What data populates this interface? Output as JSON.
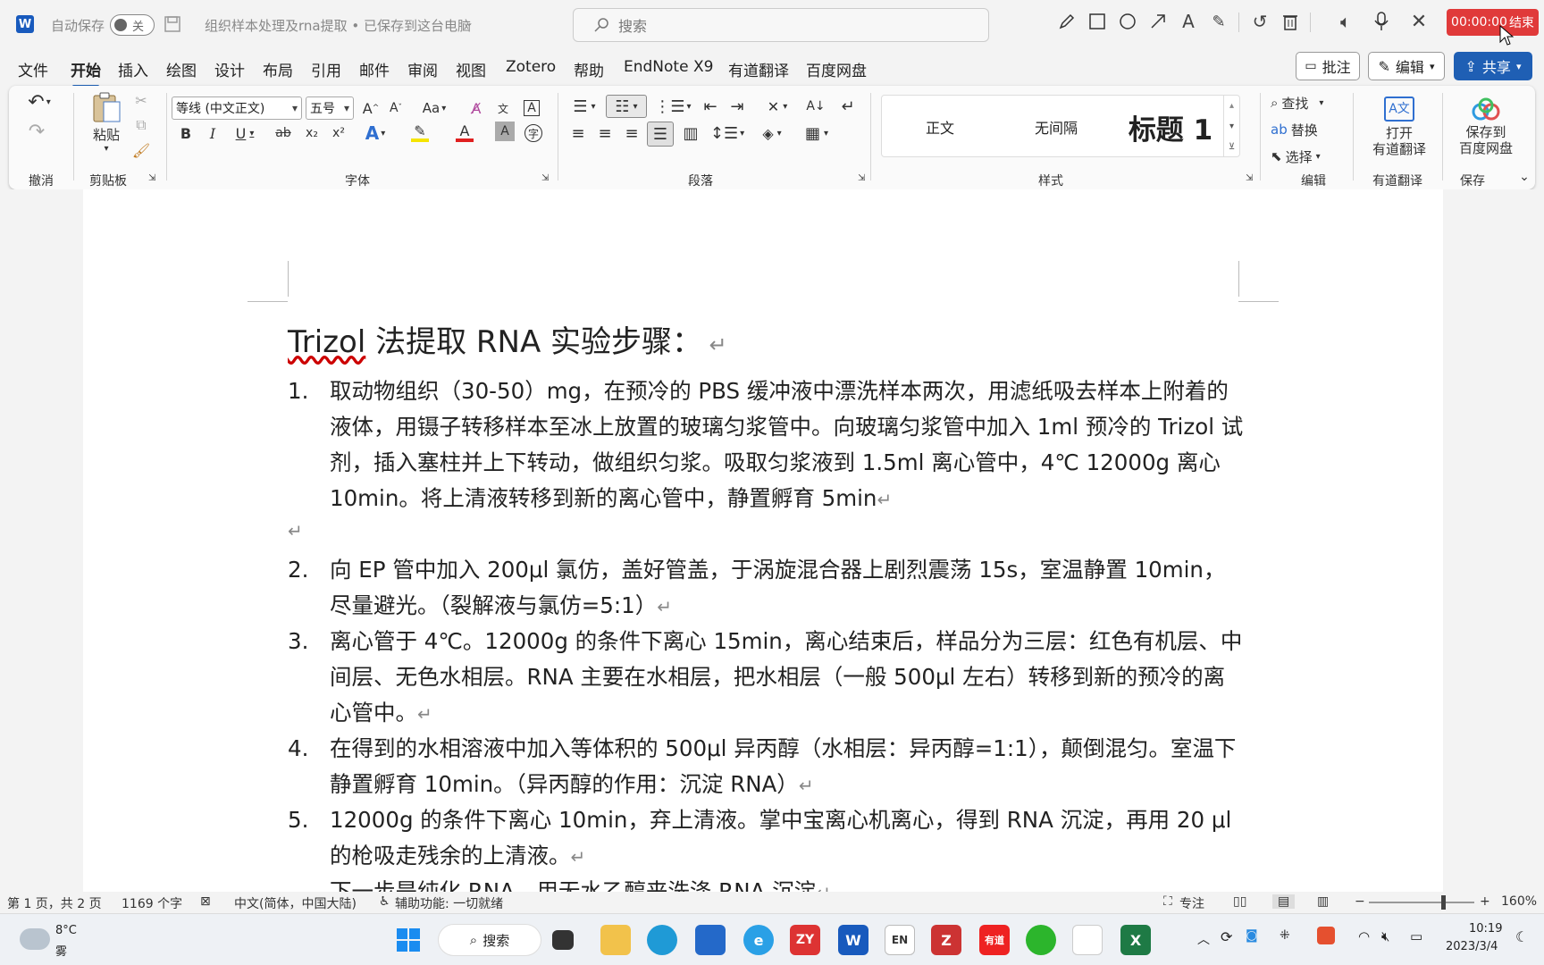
{
  "titlebar": {
    "autosave_label": "自动保存",
    "autosave_state": "关",
    "doc_title": "组织样本处理及rna提取 • 已保存到这台电脑",
    "search_placeholder": "搜索",
    "recording_time": "00:00:00",
    "recording_end": "结束"
  },
  "menu": {
    "items": [
      "文件",
      "开始",
      "插入",
      "绘图",
      "设计",
      "布局",
      "引用",
      "邮件",
      "审阅",
      "视图",
      "Zotero",
      "帮助",
      "EndNote X9",
      "有道翻译",
      "百度网盘"
    ],
    "active": "开始",
    "comment_btn": "批注",
    "edit_btn": "编辑",
    "share_btn": "共享"
  },
  "ribbon": {
    "groups": [
      "撤消",
      "剪贴板",
      "字体",
      "段落",
      "样式",
      "编辑",
      "有道翻译",
      "保存"
    ],
    "paste_label": "粘贴",
    "font_name": "等线 (中文正文)",
    "font_size": "五号",
    "styles": [
      "正文",
      "无间隔",
      "标题 1"
    ],
    "find": "查找",
    "replace": "替换",
    "select": "选择",
    "youdao_btn": "打开\n有道翻译",
    "youdao_line1": "打开",
    "youdao_line2": "有道翻译",
    "baidu_line1": "保存到",
    "baidu_line2": "百度网盘",
    "font_glyph_aa": "Aa",
    "bold": "B",
    "italic": "I",
    "underline": "U",
    "strike": "ab",
    "sub": "x₂",
    "sup": "x²"
  },
  "document": {
    "title_part1": "Trizol",
    "title_part2": " 法提取 RNA 实验步骤：",
    "items": [
      {
        "num": "1.",
        "text": "取动物组织（30-50）mg，在预冷的 PBS 缓冲液中漂洗样本两次，用滤纸吸去样本上附着的液体，用镊子转移样本至冰上放置的玻璃匀浆管中。向玻璃匀浆管中加入 1ml 预冷的 Trizol 试剂，插入塞柱并上下转动，做组织匀浆。吸取匀浆液到 1.5ml 离心管中，4℃ 12000g 离心 10min。将上清液转移到新的离心管中，静置孵育 5min"
      },
      {
        "num": "2.",
        "text": "向 EP 管中加入 200μl 氯仿，盖好管盖，于涡旋混合器上剧烈震荡 15s，室温静置 10min，尽量避光。（裂解液与氯仿=5:1）"
      },
      {
        "num": "3.",
        "text": "离心管于 4℃。12000g 的条件下离心 15min，离心结束后，样品分为三层：红色有机层、中间层、无色水相层。RNA 主要在水相层，把水相层（一般 500μl 左右）转移到新的预冷的离心管中。"
      },
      {
        "num": "4.",
        "text": "在得到的水相溶液中加入等体积的 500μl 异丙醇（水相层：异丙醇=1:1），颠倒混匀。室温下静置孵育 10min。（异丙醇的作用：沉淀 RNA）"
      },
      {
        "num": "5.",
        "text": "12000g 的条件下离心 10min，弃上清液。掌中宝离心机离心，得到 RNA 沉淀，再用 20 μl 的枪吸走残余的上清液。"
      },
      {
        "num": "",
        "text": "下一步是纯化 RNA，用无水乙醇来洗涤 RNA 沉淀"
      }
    ]
  },
  "status": {
    "page": "第 1 页，共 2 页",
    "words": "1169 个字",
    "lang": "中文(简体，中国大陆)",
    "a11y": "辅助功能: 一切就绪",
    "focus": "专注",
    "zoom": "160%",
    "zoom_level": 0.72
  },
  "taskbar": {
    "weather_temp": "8°C",
    "weather_desc": "雾",
    "search": "搜索",
    "time": "10:19",
    "date": "2023/3/4"
  }
}
